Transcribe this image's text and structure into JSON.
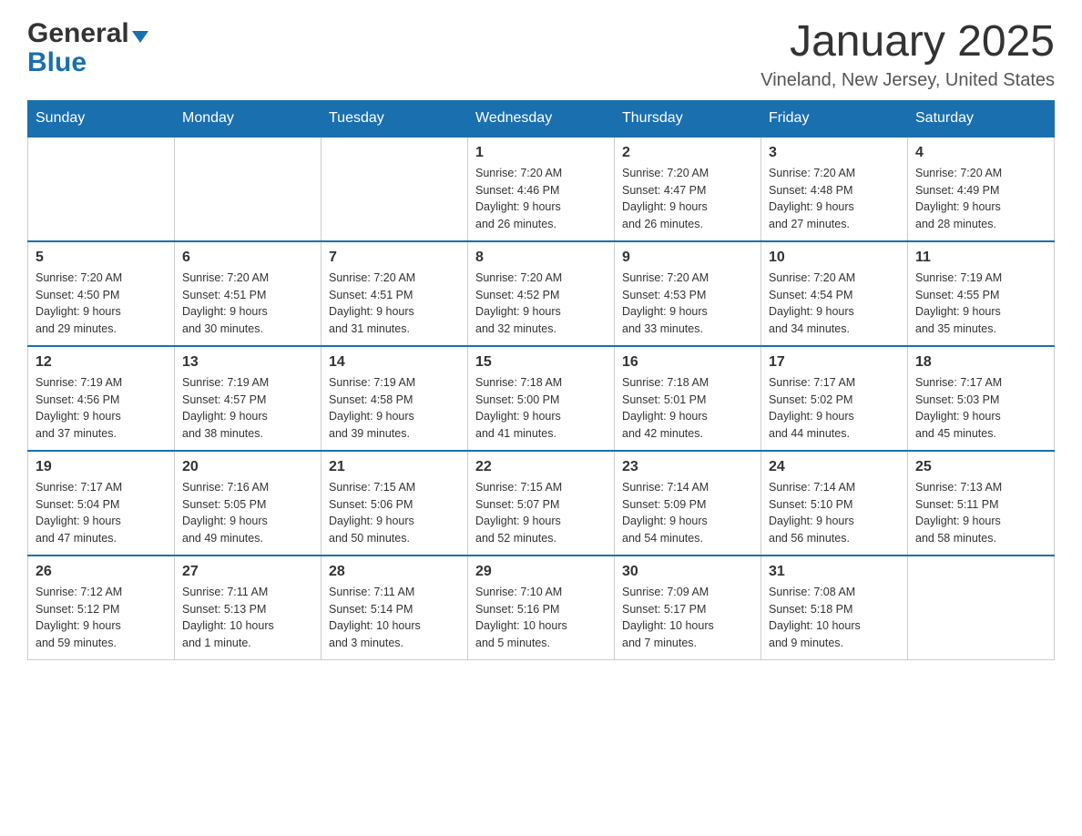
{
  "header": {
    "logo_general": "General",
    "logo_blue": "Blue",
    "month_title": "January 2025",
    "location": "Vineland, New Jersey, United States"
  },
  "days_of_week": [
    "Sunday",
    "Monday",
    "Tuesday",
    "Wednesday",
    "Thursday",
    "Friday",
    "Saturday"
  ],
  "weeks": [
    [
      {
        "day": "",
        "info": ""
      },
      {
        "day": "",
        "info": ""
      },
      {
        "day": "",
        "info": ""
      },
      {
        "day": "1",
        "info": "Sunrise: 7:20 AM\nSunset: 4:46 PM\nDaylight: 9 hours\nand 26 minutes."
      },
      {
        "day": "2",
        "info": "Sunrise: 7:20 AM\nSunset: 4:47 PM\nDaylight: 9 hours\nand 26 minutes."
      },
      {
        "day": "3",
        "info": "Sunrise: 7:20 AM\nSunset: 4:48 PM\nDaylight: 9 hours\nand 27 minutes."
      },
      {
        "day": "4",
        "info": "Sunrise: 7:20 AM\nSunset: 4:49 PM\nDaylight: 9 hours\nand 28 minutes."
      }
    ],
    [
      {
        "day": "5",
        "info": "Sunrise: 7:20 AM\nSunset: 4:50 PM\nDaylight: 9 hours\nand 29 minutes."
      },
      {
        "day": "6",
        "info": "Sunrise: 7:20 AM\nSunset: 4:51 PM\nDaylight: 9 hours\nand 30 minutes."
      },
      {
        "day": "7",
        "info": "Sunrise: 7:20 AM\nSunset: 4:51 PM\nDaylight: 9 hours\nand 31 minutes."
      },
      {
        "day": "8",
        "info": "Sunrise: 7:20 AM\nSunset: 4:52 PM\nDaylight: 9 hours\nand 32 minutes."
      },
      {
        "day": "9",
        "info": "Sunrise: 7:20 AM\nSunset: 4:53 PM\nDaylight: 9 hours\nand 33 minutes."
      },
      {
        "day": "10",
        "info": "Sunrise: 7:20 AM\nSunset: 4:54 PM\nDaylight: 9 hours\nand 34 minutes."
      },
      {
        "day": "11",
        "info": "Sunrise: 7:19 AM\nSunset: 4:55 PM\nDaylight: 9 hours\nand 35 minutes."
      }
    ],
    [
      {
        "day": "12",
        "info": "Sunrise: 7:19 AM\nSunset: 4:56 PM\nDaylight: 9 hours\nand 37 minutes."
      },
      {
        "day": "13",
        "info": "Sunrise: 7:19 AM\nSunset: 4:57 PM\nDaylight: 9 hours\nand 38 minutes."
      },
      {
        "day": "14",
        "info": "Sunrise: 7:19 AM\nSunset: 4:58 PM\nDaylight: 9 hours\nand 39 minutes."
      },
      {
        "day": "15",
        "info": "Sunrise: 7:18 AM\nSunset: 5:00 PM\nDaylight: 9 hours\nand 41 minutes."
      },
      {
        "day": "16",
        "info": "Sunrise: 7:18 AM\nSunset: 5:01 PM\nDaylight: 9 hours\nand 42 minutes."
      },
      {
        "day": "17",
        "info": "Sunrise: 7:17 AM\nSunset: 5:02 PM\nDaylight: 9 hours\nand 44 minutes."
      },
      {
        "day": "18",
        "info": "Sunrise: 7:17 AM\nSunset: 5:03 PM\nDaylight: 9 hours\nand 45 minutes."
      }
    ],
    [
      {
        "day": "19",
        "info": "Sunrise: 7:17 AM\nSunset: 5:04 PM\nDaylight: 9 hours\nand 47 minutes."
      },
      {
        "day": "20",
        "info": "Sunrise: 7:16 AM\nSunset: 5:05 PM\nDaylight: 9 hours\nand 49 minutes."
      },
      {
        "day": "21",
        "info": "Sunrise: 7:15 AM\nSunset: 5:06 PM\nDaylight: 9 hours\nand 50 minutes."
      },
      {
        "day": "22",
        "info": "Sunrise: 7:15 AM\nSunset: 5:07 PM\nDaylight: 9 hours\nand 52 minutes."
      },
      {
        "day": "23",
        "info": "Sunrise: 7:14 AM\nSunset: 5:09 PM\nDaylight: 9 hours\nand 54 minutes."
      },
      {
        "day": "24",
        "info": "Sunrise: 7:14 AM\nSunset: 5:10 PM\nDaylight: 9 hours\nand 56 minutes."
      },
      {
        "day": "25",
        "info": "Sunrise: 7:13 AM\nSunset: 5:11 PM\nDaylight: 9 hours\nand 58 minutes."
      }
    ],
    [
      {
        "day": "26",
        "info": "Sunrise: 7:12 AM\nSunset: 5:12 PM\nDaylight: 9 hours\nand 59 minutes."
      },
      {
        "day": "27",
        "info": "Sunrise: 7:11 AM\nSunset: 5:13 PM\nDaylight: 10 hours\nand 1 minute."
      },
      {
        "day": "28",
        "info": "Sunrise: 7:11 AM\nSunset: 5:14 PM\nDaylight: 10 hours\nand 3 minutes."
      },
      {
        "day": "29",
        "info": "Sunrise: 7:10 AM\nSunset: 5:16 PM\nDaylight: 10 hours\nand 5 minutes."
      },
      {
        "day": "30",
        "info": "Sunrise: 7:09 AM\nSunset: 5:17 PM\nDaylight: 10 hours\nand 7 minutes."
      },
      {
        "day": "31",
        "info": "Sunrise: 7:08 AM\nSunset: 5:18 PM\nDaylight: 10 hours\nand 9 minutes."
      },
      {
        "day": "",
        "info": ""
      }
    ]
  ]
}
